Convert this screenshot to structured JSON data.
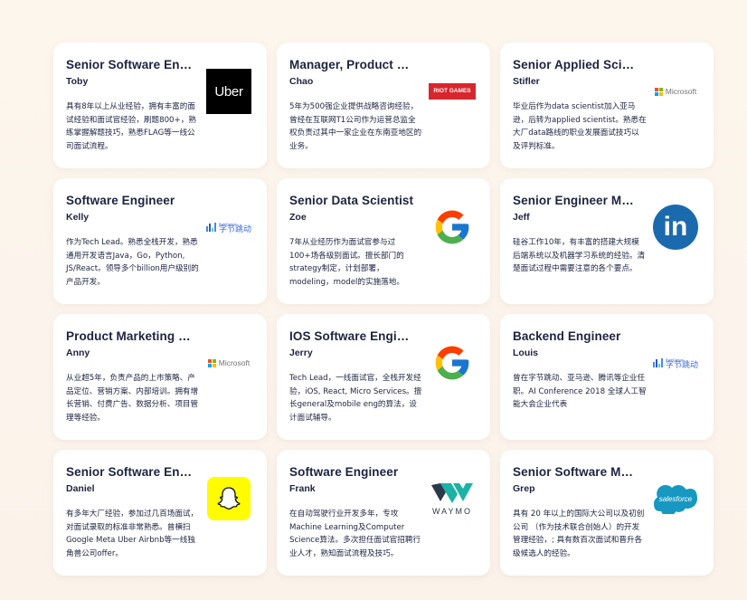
{
  "mentors": [
    {
      "title": "Senior Software Engineer",
      "name": "Toby",
      "desc": "具有8年以上从业经验，拥有丰富的面试经验和面试官经验，刷题800+，熟练掌握解题技巧，熟悉FLAG等一线公司面试流程。",
      "logo": "uber-logo",
      "logo_text": "Uber"
    },
    {
      "title": "Manager, Product Management",
      "name": "Chao",
      "desc": "5年为500强企业提供战略咨询经验，曾经在互联网T1公司作为运营总监全权负责过其中一家企业在东南亚地区的业务。",
      "logo": "riot-games-logo",
      "logo_text": "RIOT GAMES"
    },
    {
      "title": "Senior Applied Scientist",
      "name": "Stifler",
      "desc": "毕业后作为data scientist加入亚马逊，后转为applied scientist。熟悉在大厂data路线的职业发展面试技巧以及评判标准。",
      "logo": "microsoft-logo",
      "logo_text": "Microsoft"
    },
    {
      "title": "Software Engineer",
      "name": "Kelly",
      "desc": "作为Tech Lead。熟悉全栈开发，熟悉通用开发语言Java，Go，Python, JS/React。领导多个billion用户级别的产品开发。",
      "logo": "bytedance-logo",
      "logo_text": "字节跳动",
      "logo_sub": "ByteDance"
    },
    {
      "title": "Senior Data Scientist",
      "name": "Zoe",
      "desc": "7年从业经历作为面试官参与过100+场各级别面试。擅长部门的strategy制定，计划部署，modeling，model的实施落地。",
      "logo": "google-logo",
      "logo_text": ""
    },
    {
      "title": "Senior Engineer Manager",
      "name": "Jeff",
      "desc": "硅谷工作10年，有丰富的搭建大规模后端系统以及机器学习系统的经验。清楚面试过程中需要注意的各个要点。",
      "logo": "linkedin-logo",
      "logo_text": "in"
    },
    {
      "title": "Product Marketing Manager",
      "name": "Anny",
      "desc": "从业超5年，负责产品的上市策略、产品定位、营销方案、内部培训。拥有增长营销、付费广告、数据分析、项目管理等经验。",
      "logo": "microsoft-logo",
      "logo_text": "Microsoft"
    },
    {
      "title": "IOS Software Engineer",
      "name": "Jerry",
      "desc": "Tech Lead，一线面试官，全栈开发经验，iOS, React, Micro Services。擅长general及mobile eng的算法，设计面试辅导。",
      "logo": "google-logo",
      "logo_text": ""
    },
    {
      "title": "Backend Engineer",
      "name": "Louis",
      "desc": "曾在字节跳动、亚马逊、腾讯等企业任职。AI Conference 2018 全球人工智能大会企业代表",
      "logo": "bytedance-logo",
      "logo_text": "字节跳动",
      "logo_sub": "ByteDance"
    },
    {
      "title": "Senior Software Engineer",
      "name": "Daniel",
      "desc": "有多年大厂经验，参加过几百场面试，对面试录取的标准非常熟悉。曾横扫Google Meta Uber Airbnb等一线独角兽公司offer。",
      "logo": "snapchat-logo",
      "logo_text": ""
    },
    {
      "title": "Software Engineer",
      "name": "Frank",
      "desc": "在自动驾驶行业开发多年，专攻Machine Learning及Computer Science算法。多次担任面试官招聘行业人才，熟知面试流程及技巧。",
      "logo": "waymo-logo",
      "logo_text": "WAYMO"
    },
    {
      "title": "Senior Software Manager",
      "name": "Grep",
      "desc": "具有 20 年以上的国际大公司以及初创公司 （作为技术联合创始人）的开发管理经验，; 具有数百次面试和晋升各级候选人的经验。",
      "logo": "salesforce-logo",
      "logo_text": "salesforce"
    }
  ],
  "colors": {
    "title": "#1c2340",
    "uber": "#000000",
    "riot": "#d7262c",
    "linkedin": "#1c6aae",
    "snapchat": "#fffc00",
    "salesforce": "#1798c1"
  }
}
